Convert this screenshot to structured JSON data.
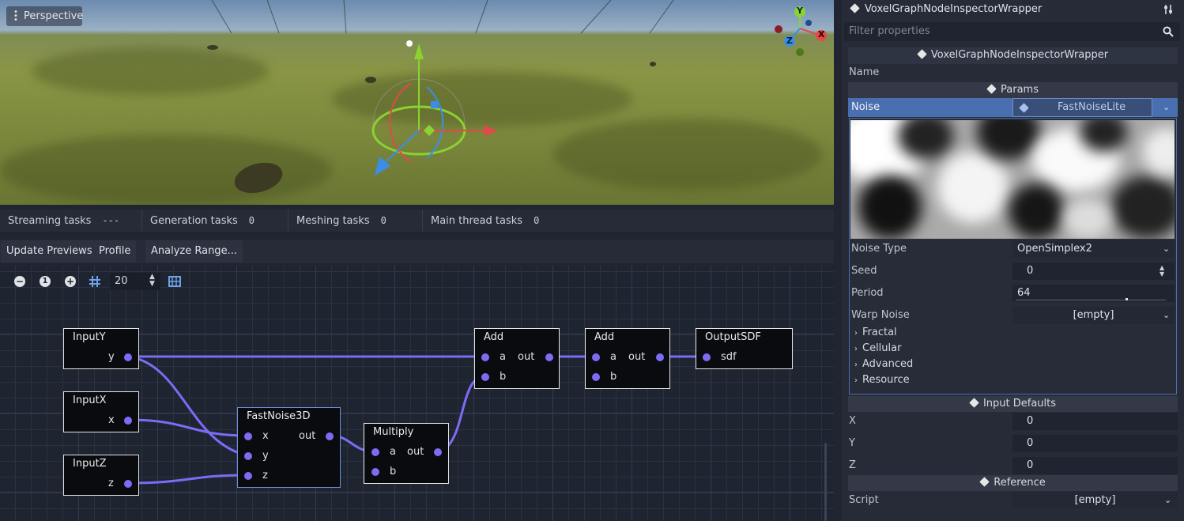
{
  "viewport": {
    "perspective_label": "Perspective",
    "gizmo_axes": {
      "x": "X",
      "y": "Y",
      "z": "Z"
    },
    "colors": {
      "x_axis": "#e04a4a",
      "y_axis": "#8ad232",
      "z_axis": "#3b8ee8"
    }
  },
  "stats": [
    {
      "label": "Streaming tasks",
      "value": "---"
    },
    {
      "label": "Generation tasks",
      "value": "0"
    },
    {
      "label": "Meshing tasks",
      "value": "0"
    },
    {
      "label": "Main thread tasks",
      "value": "0"
    }
  ],
  "graph_toolbar": {
    "update_previews": "Update Previews",
    "profile": "Profile",
    "analyze_range": "Analyze Range...",
    "zoom_reset": "1",
    "snap_distance": "20"
  },
  "graph": {
    "wire_color": "#7b6cf5",
    "nodes": {
      "input_y": {
        "title": "InputY",
        "out": "y"
      },
      "input_x": {
        "title": "InputX",
        "out": "x"
      },
      "input_z": {
        "title": "InputZ",
        "out": "z"
      },
      "fastnoise": {
        "title": "FastNoise3D",
        "in": [
          "x",
          "y",
          "z"
        ],
        "out": "out"
      },
      "multiply": {
        "title": "Multiply",
        "in": [
          "a",
          "b"
        ],
        "out": "out"
      },
      "add1": {
        "title": "Add",
        "in": [
          "a",
          "b"
        ],
        "out": "out"
      },
      "add2": {
        "title": "Add",
        "in": [
          "a",
          "b"
        ],
        "out": "out"
      },
      "output": {
        "title": "OutputSDF",
        "in": [
          "sdf"
        ]
      }
    }
  },
  "inspector": {
    "header_title": "VoxelGraphNodeInspectorWrapper",
    "filter_placeholder": "Filter properties",
    "class_title": "VoxelGraphNodeInspectorWrapper",
    "name_label": "Name",
    "params_section": "Params",
    "noise_label": "Noise",
    "noise_resource": "FastNoiseLite",
    "noise_type_label": "Noise Type",
    "noise_type_value": "OpenSimplex2",
    "seed_label": "Seed",
    "seed_value": "0",
    "period_label": "Period",
    "period_value": "64",
    "warp_noise_label": "Warp Noise",
    "warp_noise_value": "[empty]",
    "groups": [
      "Fractal",
      "Cellular",
      "Advanced",
      "Resource"
    ],
    "input_defaults_section": "Input Defaults",
    "inputs": [
      {
        "label": "X",
        "value": "0"
      },
      {
        "label": "Y",
        "value": "0"
      },
      {
        "label": "Z",
        "value": "0"
      }
    ],
    "reference_section": "Reference",
    "script_label": "Script",
    "script_value": "[empty]",
    "accent_color": "#4a6fb0"
  }
}
